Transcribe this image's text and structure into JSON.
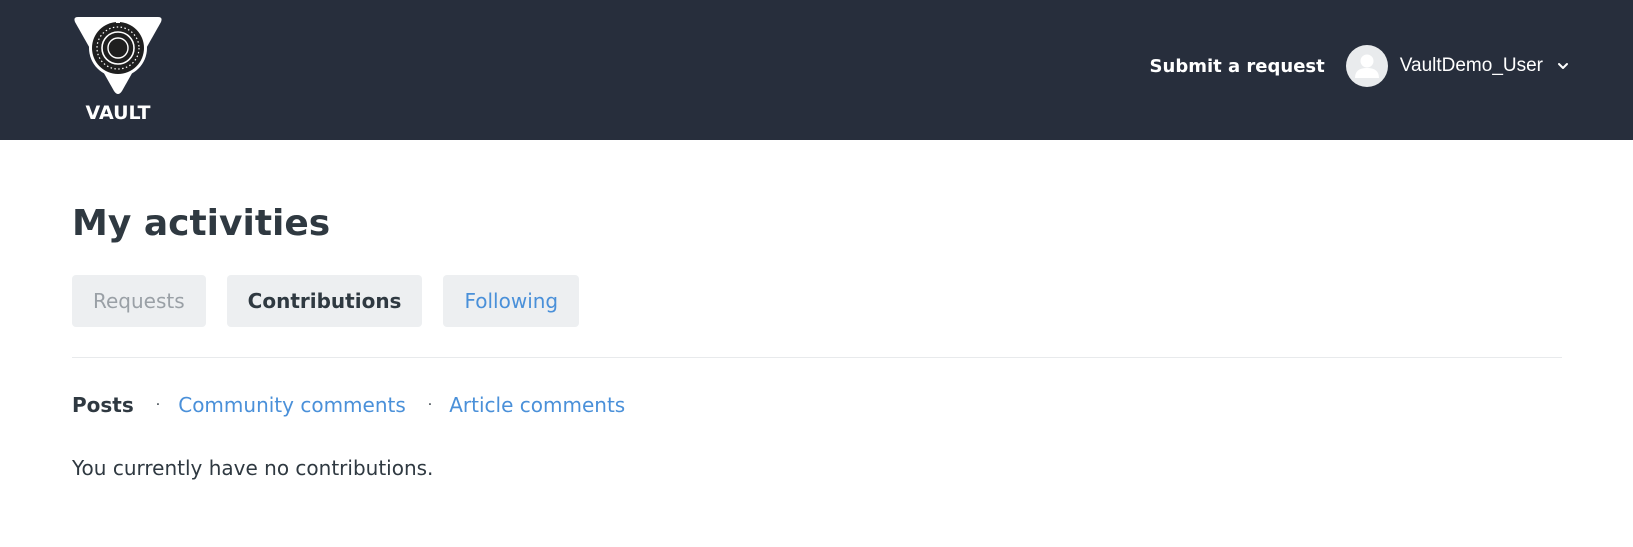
{
  "header": {
    "logo_text": "VAULT",
    "submit_request": "Submit a request",
    "user_name": "VaultDemo_User",
    "background": "#272e3c"
  },
  "page": {
    "title": "My activities"
  },
  "tabs": [
    {
      "label": "Requests",
      "state": "disabled"
    },
    {
      "label": "Contributions",
      "state": "active"
    },
    {
      "label": "Following",
      "state": "link"
    }
  ],
  "subnav": {
    "active": "Posts",
    "separator": "·",
    "links": [
      "Community comments",
      "Article comments"
    ]
  },
  "empty_message": "You currently have no contributions.",
  "colors": {
    "link": "#4a90d9",
    "text": "#2f3941",
    "tab_bg": "#edeff1"
  },
  "icons": {
    "logo": "vault-safe-dial-logo",
    "avatar": "user-avatar-icon",
    "menu": "chevron-down-icon"
  }
}
